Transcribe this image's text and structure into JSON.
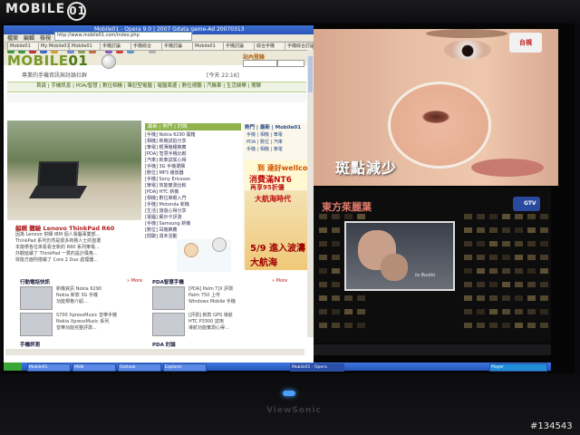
{
  "watermark": {
    "prefix": "MOBILE",
    "suffix": "01"
  },
  "browser": {
    "title": "Mobile01 - Opera 9.0 | 2007 Gdata game-Ad 20070313",
    "menu": [
      "檔案",
      "編輯",
      "檢視",
      "書籤",
      "工具",
      "說明"
    ],
    "address": "http://www.mobile01.com/index.php",
    "tabs": [
      "Mobile01",
      "My Mobile01",
      "Mobile01",
      "手機討論",
      "手機綜合",
      "手機討論",
      "Mobile01",
      "手機討論",
      "綜合手機",
      "手機綜合討論"
    ]
  },
  "site": {
    "logo_prefix": "MOBILE",
    "logo_suffix": "01",
    "login_label": "站內登錄",
    "slogan_left": "專業的手機資訊與討論社群",
    "slogan_mid": "",
    "slogan_right": "[今天 22:16]",
    "nav": "首頁 | 手機訊息 | PDA/智慧 | 數位相機 | 筆記型電腦 | 電腦周邊 | 數位視聽 | 汽機車 | 生活娛樂 | 閒聊",
    "headline": "編輯 體驗 Lenovo ThinkPad R60",
    "headline_body": [
      "因為 Lenovo 併購 IBM 個人電腦事業部...",
      "ThinkPad 系列仍然是很多商務人士的首選",
      "本篇帶各位來看看全新的 R60 系列筆電...",
      "外觀延續了 ThinkPad 一貫的設計風格...",
      "效能方面則搭載了 Core 2 Duo 處理器..."
    ],
    "list_header": "最新 | 熱門 | 討論",
    "list_items": [
      "[手機] Nokia 6290 開箱",
      "[相機] 新機試拍分享",
      "[筆電] 輕薄機種推薦",
      "[PDA] 智慧手機比較",
      "[汽車] 新車試駕心得",
      "[手機] 3G 手機選購",
      "[數位] MP3 播放器",
      "[手機] Sony Ericsson",
      "[筆電] 效能實測比較",
      "[PDA] HTC 新機",
      "[相機] 數位單眼入門",
      "[手機] Motorola 新機",
      "[生活] 旅遊心得分享",
      "[電腦] 顯示卡評測",
      "[手機] Samsung 新機",
      "[數位] 耳機推薦",
      "[閒聊] 週末活動"
    ],
    "right_header": "熱門 | 最新 | Mobile01",
    "right_items": [
      "手機 | 相機 | 筆電",
      "PDA | 數位 | 汽車",
      "手機 | 相機 | 筆電"
    ],
    "ad1_line1": "到 達好wellcome",
    "ad1_line2": "消費滿NT6",
    "ad1_line3": "再享95折優",
    "ad2_line1": "大航海時代",
    "ad2_line2": "5/9 進入波濤",
    "ad2_line3": "大航海",
    "sections": [
      {
        "title": "行動電話快訊",
        "more": "» More",
        "lines": [
          "新機資訊 Nokia 6290",
          "Nokia 新款 3G 手機",
          "功能規格介紹..."
        ]
      },
      {
        "title": "PDA智慧手機",
        "more": "» More",
        "lines": [
          "[PDA] Palm T|X 評測",
          "Palm 750 上市",
          "Windows Mobile 手機"
        ]
      }
    ],
    "sections_lower": [
      {
        "title": "",
        "lines": [
          "S700 XpressMusic 音樂手機",
          "Nokia XpressMusic 系列",
          "音樂功能完整評測..."
        ]
      },
      {
        "title": "",
        "lines": [
          "[評測] 新款 GPS 導航",
          "HTC P3300 試用",
          "導航功能實測心得..."
        ]
      }
    ],
    "bottom_left": "手機評測",
    "bottom_right": "PDA 討論"
  },
  "taskbar": {
    "items": [
      "Mobile01",
      "MSN",
      "Outlook",
      "Explorer",
      "Mobile01 - Opera",
      "Player"
    ]
  },
  "tv": {
    "top_caption": "斑點減少",
    "top_logo": "台視",
    "show_title": "東方茱麗葉",
    "channel": "GTV",
    "poster_text": "to Bustin"
  },
  "bezel": {
    "brand": "ViewSonic",
    "id_label": "#134543"
  }
}
